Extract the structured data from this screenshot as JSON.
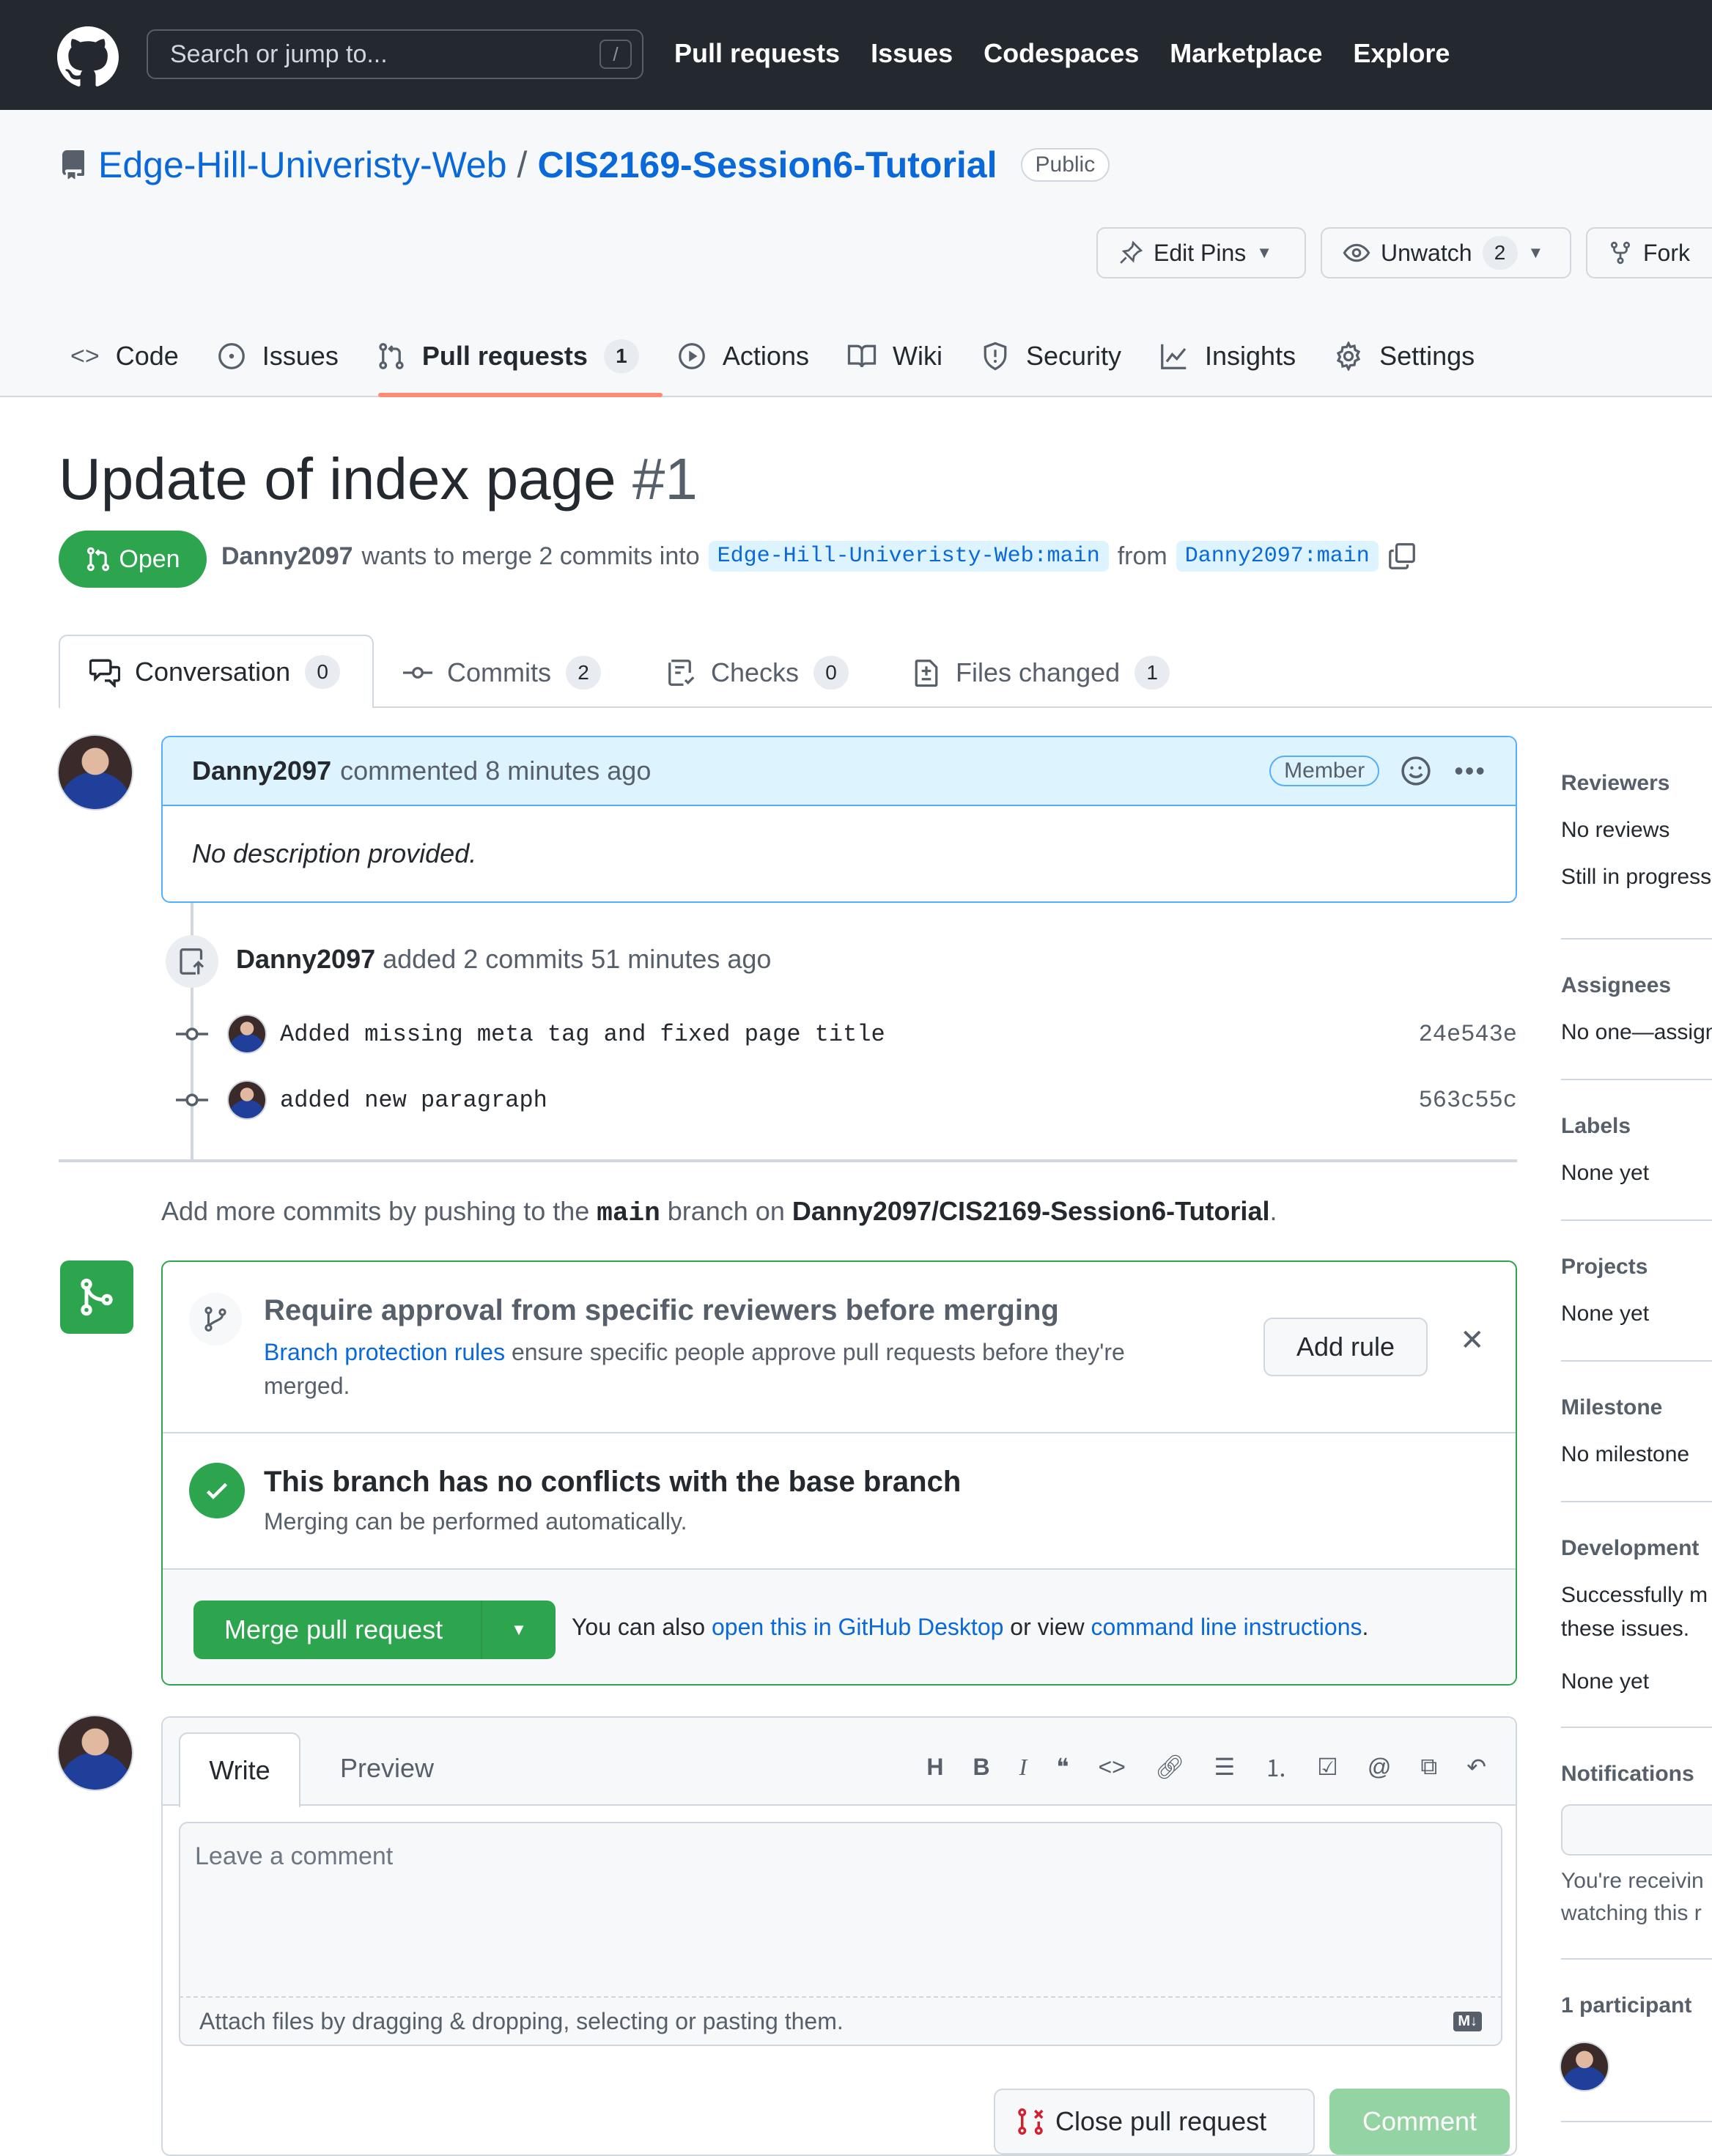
{
  "header": {
    "search_placeholder": "Search or jump to...",
    "search_key": "/",
    "nav": [
      "Pull requests",
      "Issues",
      "Codespaces",
      "Marketplace",
      "Explore"
    ]
  },
  "repo": {
    "owner": "Edge-Hill-Univeristy-Web",
    "separator": "/",
    "name": "CIS2169-Session6-Tutorial",
    "visibility": "Public",
    "edit_pins": "Edit Pins",
    "unwatch": "Unwatch",
    "watch_count": "2",
    "fork": "Fork",
    "tabs": [
      {
        "label": "Code",
        "icon": "code-icon"
      },
      {
        "label": "Issues",
        "icon": "issue-icon"
      },
      {
        "label": "Pull requests",
        "icon": "pull-request-icon",
        "count": "1"
      },
      {
        "label": "Actions",
        "icon": "play-icon"
      },
      {
        "label": "Wiki",
        "icon": "book-icon"
      },
      {
        "label": "Security",
        "icon": "shield-icon"
      },
      {
        "label": "Insights",
        "icon": "graph-icon"
      },
      {
        "label": "Settings",
        "icon": "gear-icon"
      }
    ]
  },
  "pr": {
    "title": "Update of index page",
    "number": "#1",
    "state": "Open",
    "author": "Danny2097",
    "merge_text": "wants to merge 2 commits into",
    "base_branch": "Edge-Hill-Univeristy-Web:main",
    "from_text": "from",
    "head_branch": "Danny2097:main",
    "tabs": [
      {
        "label": "Conversation",
        "count": "0",
        "icon": "comment-discussion-icon"
      },
      {
        "label": "Commits",
        "count": "2",
        "icon": "commit-icon"
      },
      {
        "label": "Checks",
        "count": "0",
        "icon": "checklist-icon"
      },
      {
        "label": "Files changed",
        "count": "1",
        "icon": "file-diff-icon"
      }
    ]
  },
  "comment": {
    "author": "Danny2097",
    "action": "commented 8 minutes ago",
    "badge": "Member",
    "body": "No description provided."
  },
  "push_event": {
    "author": "Danny2097",
    "text": "added 2 commits 51 minutes ago"
  },
  "commits": [
    {
      "message": "Added missing meta tag and fixed page title",
      "sha": "24e543e"
    },
    {
      "message": "added new paragraph",
      "sha": "563c55c"
    }
  ],
  "more_commits": {
    "prefix": "Add more commits by pushing to the",
    "branch": "main",
    "middle": "branch on",
    "repo": "Danny2097/CIS2169-Session6-Tutorial",
    "suffix": "."
  },
  "merge_box": {
    "protection_title": "Require approval from specific reviewers before merging",
    "protection_link": "Branch protection rules",
    "protection_text": "ensure specific people approve pull requests before they're merged.",
    "add_rule": "Add rule",
    "conflict_title": "This branch has no conflicts with the base branch",
    "conflict_sub": "Merging can be performed automatically.",
    "merge_button": "Merge pull request",
    "also_text": "You can also",
    "desktop_link": "open this in GitHub Desktop",
    "or_view": "or view",
    "cli_link": "command line instructions",
    "period": "."
  },
  "composer": {
    "write": "Write",
    "preview": "Preview",
    "placeholder": "Leave a comment",
    "attach": "Attach files by dragging & dropping, selecting or pasting them.",
    "close_pr": "Close pull request",
    "comment": "Comment",
    "toolbar_icons": [
      "heading-icon",
      "bold-icon",
      "italic-icon",
      "quote-icon",
      "code-icon",
      "link-icon",
      "unordered-list-icon",
      "ordered-list-icon",
      "task-list-icon",
      "mention-icon",
      "cross-reference-icon",
      "reply-icon"
    ]
  },
  "sidebar": {
    "reviewers_h": "Reviewers",
    "reviewers_1": "No reviews",
    "reviewers_2": "Still in progress",
    "assignees_h": "Assignees",
    "assignees_1": "No one—assign",
    "labels_h": "Labels",
    "labels_1": "None yet",
    "projects_h": "Projects",
    "projects_1": "None yet",
    "milestone_h": "Milestone",
    "milestone_1": "No milestone",
    "development_h": "Development",
    "development_1": "Successfully m",
    "development_2": "these issues.",
    "development_3": "None yet",
    "notifications_h": "Notifications",
    "notifications_1": "You're receivin",
    "notifications_2": "watching this r",
    "participants_h": "1 participant"
  },
  "colors": {
    "header_bg": "#24292f",
    "accent_link": "#0969da",
    "open_green": "#2da44e",
    "tab_underline": "#fd8c73"
  }
}
